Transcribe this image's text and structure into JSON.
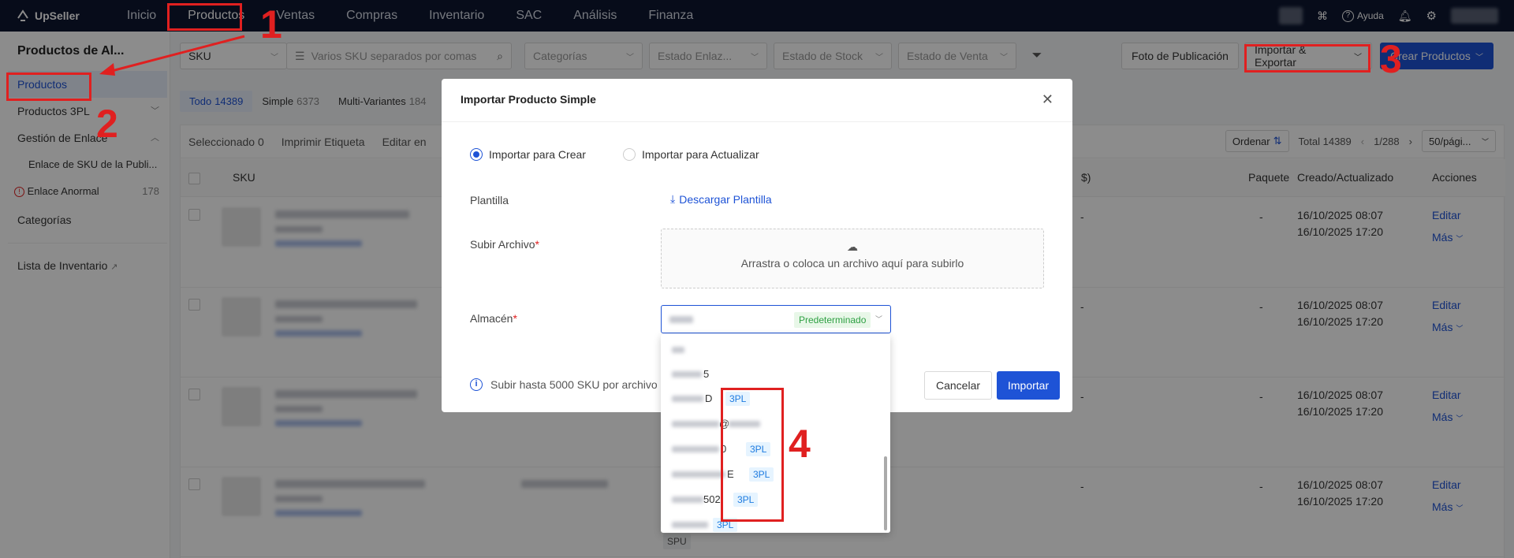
{
  "nav": {
    "logo": "UpSeller",
    "items": [
      "Inicio",
      "Productos",
      "Ventas",
      "Compras",
      "Inventario",
      "SAC",
      "Análisis",
      "Finanza"
    ],
    "help": "Ayuda"
  },
  "sidebar": {
    "title": "Productos de Al...",
    "productos": "Productos",
    "productos3pl": "Productos 3PL",
    "gestion": "Gestión de Enlace",
    "enlace_sku": "Enlace de SKU de la Publi...",
    "enlace_anormal": "Enlace Anormal",
    "enlace_anormal_count": "178",
    "categorias": "Categorías",
    "lista_inventario": "Lista de Inventario"
  },
  "filters": {
    "sku": "SKU",
    "sku_search_placeholder": "Varios SKU separados por comas",
    "categorias": "Categorías",
    "estado_enlace": "Estado Enlaz...",
    "estado_stock": "Estado de Stock",
    "estado_venta": "Estado de Venta",
    "foto_publicacion": "Foto de Publicación",
    "importar_exportar": "Importar & Exportar",
    "crear_productos": "Crear Productos"
  },
  "tabs": [
    {
      "label": "Todo",
      "count": "14389"
    },
    {
      "label": "Simple",
      "count": "6373"
    },
    {
      "label": "Multi-Variantes",
      "count": "184"
    }
  ],
  "actions": {
    "seleccionado": "Seleccionado",
    "seleccionado_count": "0",
    "imprimir": "Imprimir Etiqueta",
    "editar": "Editar en",
    "ordenar": "Ordenar",
    "total": "Total 14389",
    "page": "1/288",
    "per_page": "50/pági..."
  },
  "table": {
    "headers": {
      "sku": "SKU",
      "price": "$)",
      "paquete": "Paquete",
      "creado": "Creado/Actualizado",
      "acciones": "Acciones"
    },
    "rows": [
      {
        "dash1": "-",
        "dash2": "-",
        "created": "16/10/2025 08:07",
        "updated": "16/10/2025 17:20",
        "editar": "Editar",
        "mas": "Más"
      },
      {
        "dash1": "-",
        "dash2": "-",
        "created": "16/10/2025 08:07",
        "updated": "16/10/2025 17:20",
        "editar": "Editar",
        "mas": "Más"
      },
      {
        "dash1": "-",
        "dash2": "-",
        "created": "16/10/2025 08:07",
        "updated": "16/10/2025 17:20",
        "editar": "Editar",
        "mas": "Más"
      },
      {
        "dash1": "-",
        "dash2": "-",
        "created": "16/10/2025 08:07",
        "updated": "16/10/2025 17:20",
        "editar": "Editar",
        "mas": "Más"
      }
    ],
    "spu": "SPU"
  },
  "modal": {
    "title": "Importar Producto Simple",
    "radio_crear": "Importar para Crear",
    "radio_actualizar": "Importar para Actualizar",
    "plantilla_label": "Plantilla",
    "descargar": "Descargar Plantilla",
    "subir_label": "Subir Archivo",
    "upload_text": "Arrastra o coloca un archivo aquí para subirlo",
    "almacen_label": "Almacén",
    "default_badge": "Predeterminado",
    "info": "Subir hasta 5000 SKU por archivo",
    "cancel": "Cancelar",
    "import": "Importar"
  },
  "dropdown": {
    "items": [
      {
        "suffix": "",
        "tag": ""
      },
      {
        "suffix": "5",
        "tag": ""
      },
      {
        "suffix": "D",
        "tag": "3PL"
      },
      {
        "suffix": "@",
        "tag": ""
      },
      {
        "suffix": "0",
        "tag": "3PL"
      },
      {
        "suffix": "E",
        "tag": "3PL"
      },
      {
        "suffix": "502",
        "tag": "3PL"
      },
      {
        "suffix": "",
        "tag": "3PL"
      }
    ]
  },
  "annotations": {
    "n1": "1",
    "n2": "2",
    "n3": "3",
    "n4": "4"
  },
  "colors": {
    "primary": "#1e53d6",
    "nav_bg": "#0d1630",
    "annotation": "#e02020",
    "tag_3pl": "#1e7be0",
    "default_badge": "#2ea043"
  }
}
